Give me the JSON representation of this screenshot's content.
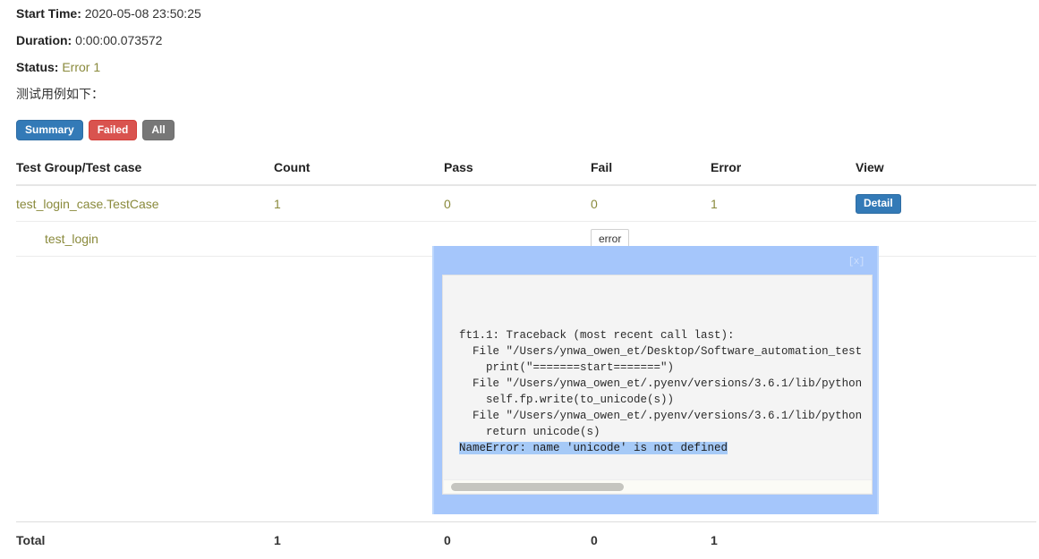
{
  "report": {
    "start_time_label": "Start Time:",
    "start_time_value": "2020-05-08 23:50:25",
    "duration_label": "Duration:",
    "duration_value": "0:00:00.073572",
    "status_label": "Status:",
    "status_value": "Error 1",
    "note": "测试用例如下："
  },
  "filters": [
    {
      "label": "Summary",
      "style": "primary"
    },
    {
      "label": "Failed",
      "style": "danger"
    },
    {
      "label": "All",
      "style": "gray"
    }
  ],
  "table": {
    "headers": {
      "name": "Test Group/Test case",
      "count": "Count",
      "pass": "Pass",
      "fail": "Fail",
      "error": "Error",
      "view": "View"
    },
    "group_row": {
      "name": "test_login_case.TestCase",
      "count": "1",
      "pass": "0",
      "fail": "0",
      "error": "1",
      "view_button": "Detail"
    },
    "case_row": {
      "name": "test_login",
      "error_button": "error"
    },
    "total_row": {
      "label": "Total",
      "count": "1",
      "pass": "0",
      "fail": "0",
      "error": "1"
    }
  },
  "popup": {
    "close_label": "[x]",
    "traceback_line1": "ft1.1: Traceback (most recent call last):",
    "traceback_line2": "  File \"/Users/ynwa_owen_et/Desktop/Software_automation_test",
    "traceback_line3": "    print(\"=======start=======\")",
    "traceback_line4": "  File \"/Users/ynwa_owen_et/.pyenv/versions/3.6.1/lib/python",
    "traceback_line5": "    self.fp.write(to_unicode(s))",
    "traceback_line6": "  File \"/Users/ynwa_owen_et/.pyenv/versions/3.6.1/lib/python",
    "traceback_line7": "    return unicode(s)",
    "traceback_line8": "NameError: name 'unicode' is not defined"
  },
  "colors": {
    "primary": "#337ab7",
    "danger": "#d9534f",
    "gray": "#777777",
    "popup_bg": "#a5c6fb",
    "pass_green": "#1a7a1a",
    "fail_red": "#b22222",
    "error_olive": "#8a8a3c"
  }
}
